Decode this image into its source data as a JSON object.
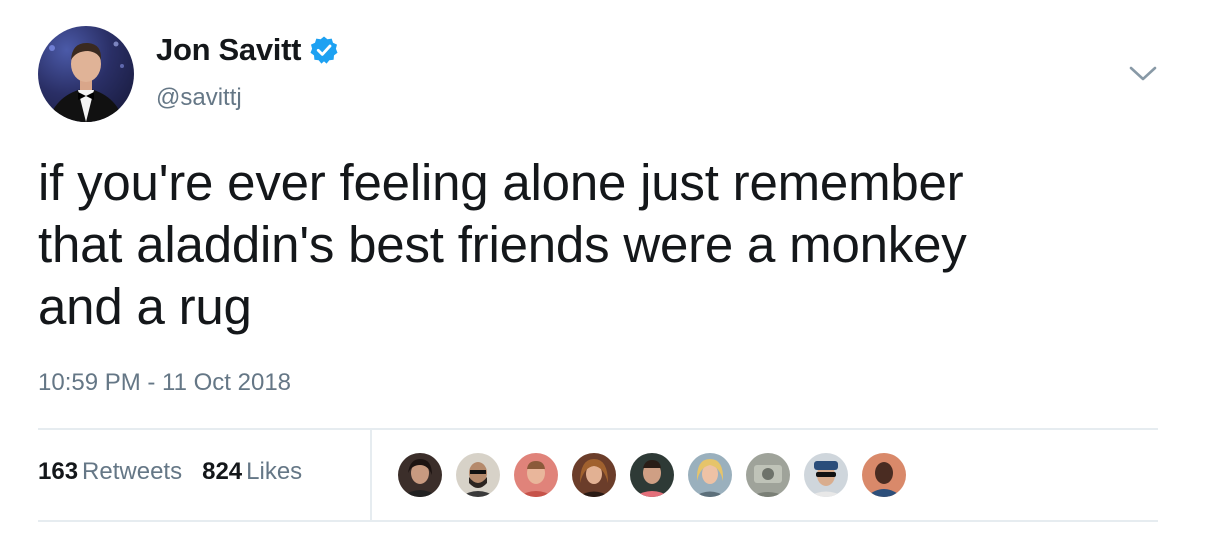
{
  "author": {
    "display_name": "Jon Savitt",
    "handle": "@savittj"
  },
  "tweet": {
    "text_lines": [
      "if you're ever feeling alone just remember",
      "that aladdin's best friends were a monkey",
      "and a rug"
    ],
    "timestamp": "10:59 PM - 11 Oct 2018"
  },
  "stats": {
    "retweets_count": "163",
    "retweets_label": "Retweets",
    "likes_count": "824",
    "likes_label": "Likes"
  },
  "icons": {
    "verified": "verified-badge-icon",
    "menu": "chevron-down-icon"
  },
  "colors": {
    "verified_blue": "#1da1f2",
    "secondary_text": "#657786",
    "primary_text": "#14171a",
    "divider": "#e6ecf0"
  }
}
